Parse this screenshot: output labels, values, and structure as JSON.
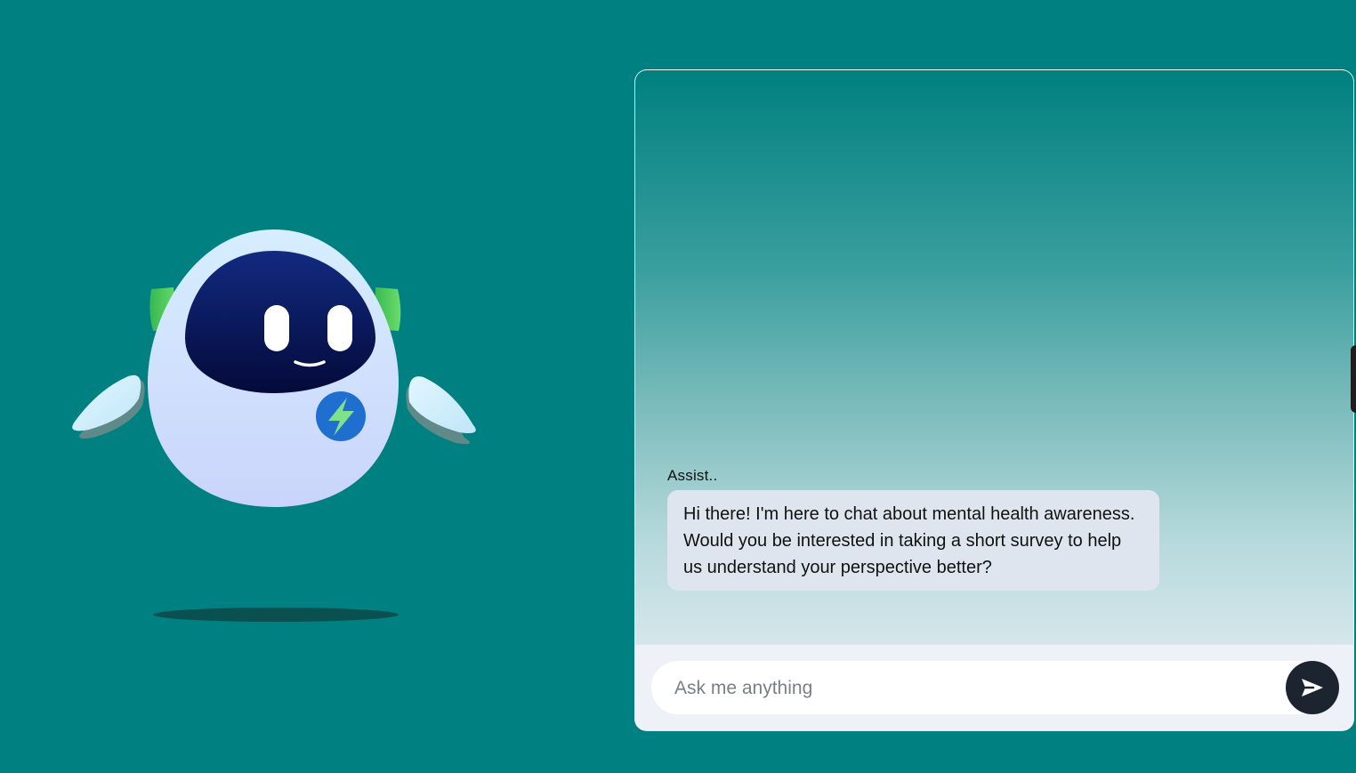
{
  "mascot": {
    "icon": "robot-mascot-icon",
    "badge_icon": "lightning-bolt-icon"
  },
  "chat": {
    "messages": [
      {
        "sender": "Assist..",
        "text": "Hi there! I'm here to chat about mental health awareness. Would you be interested in taking a short survey to help us understand your perspective better?"
      }
    ],
    "input": {
      "placeholder": "Ask me anything",
      "value": ""
    },
    "send_icon": "send-arrow-icon"
  },
  "colors": {
    "background": "#008080",
    "send_button": "#1c2430",
    "bubble": "#dfe5ee",
    "robot_visor": "#0a1a5c",
    "robot_ears": "#4cc94c",
    "robot_badge": "#1e6fd0"
  }
}
